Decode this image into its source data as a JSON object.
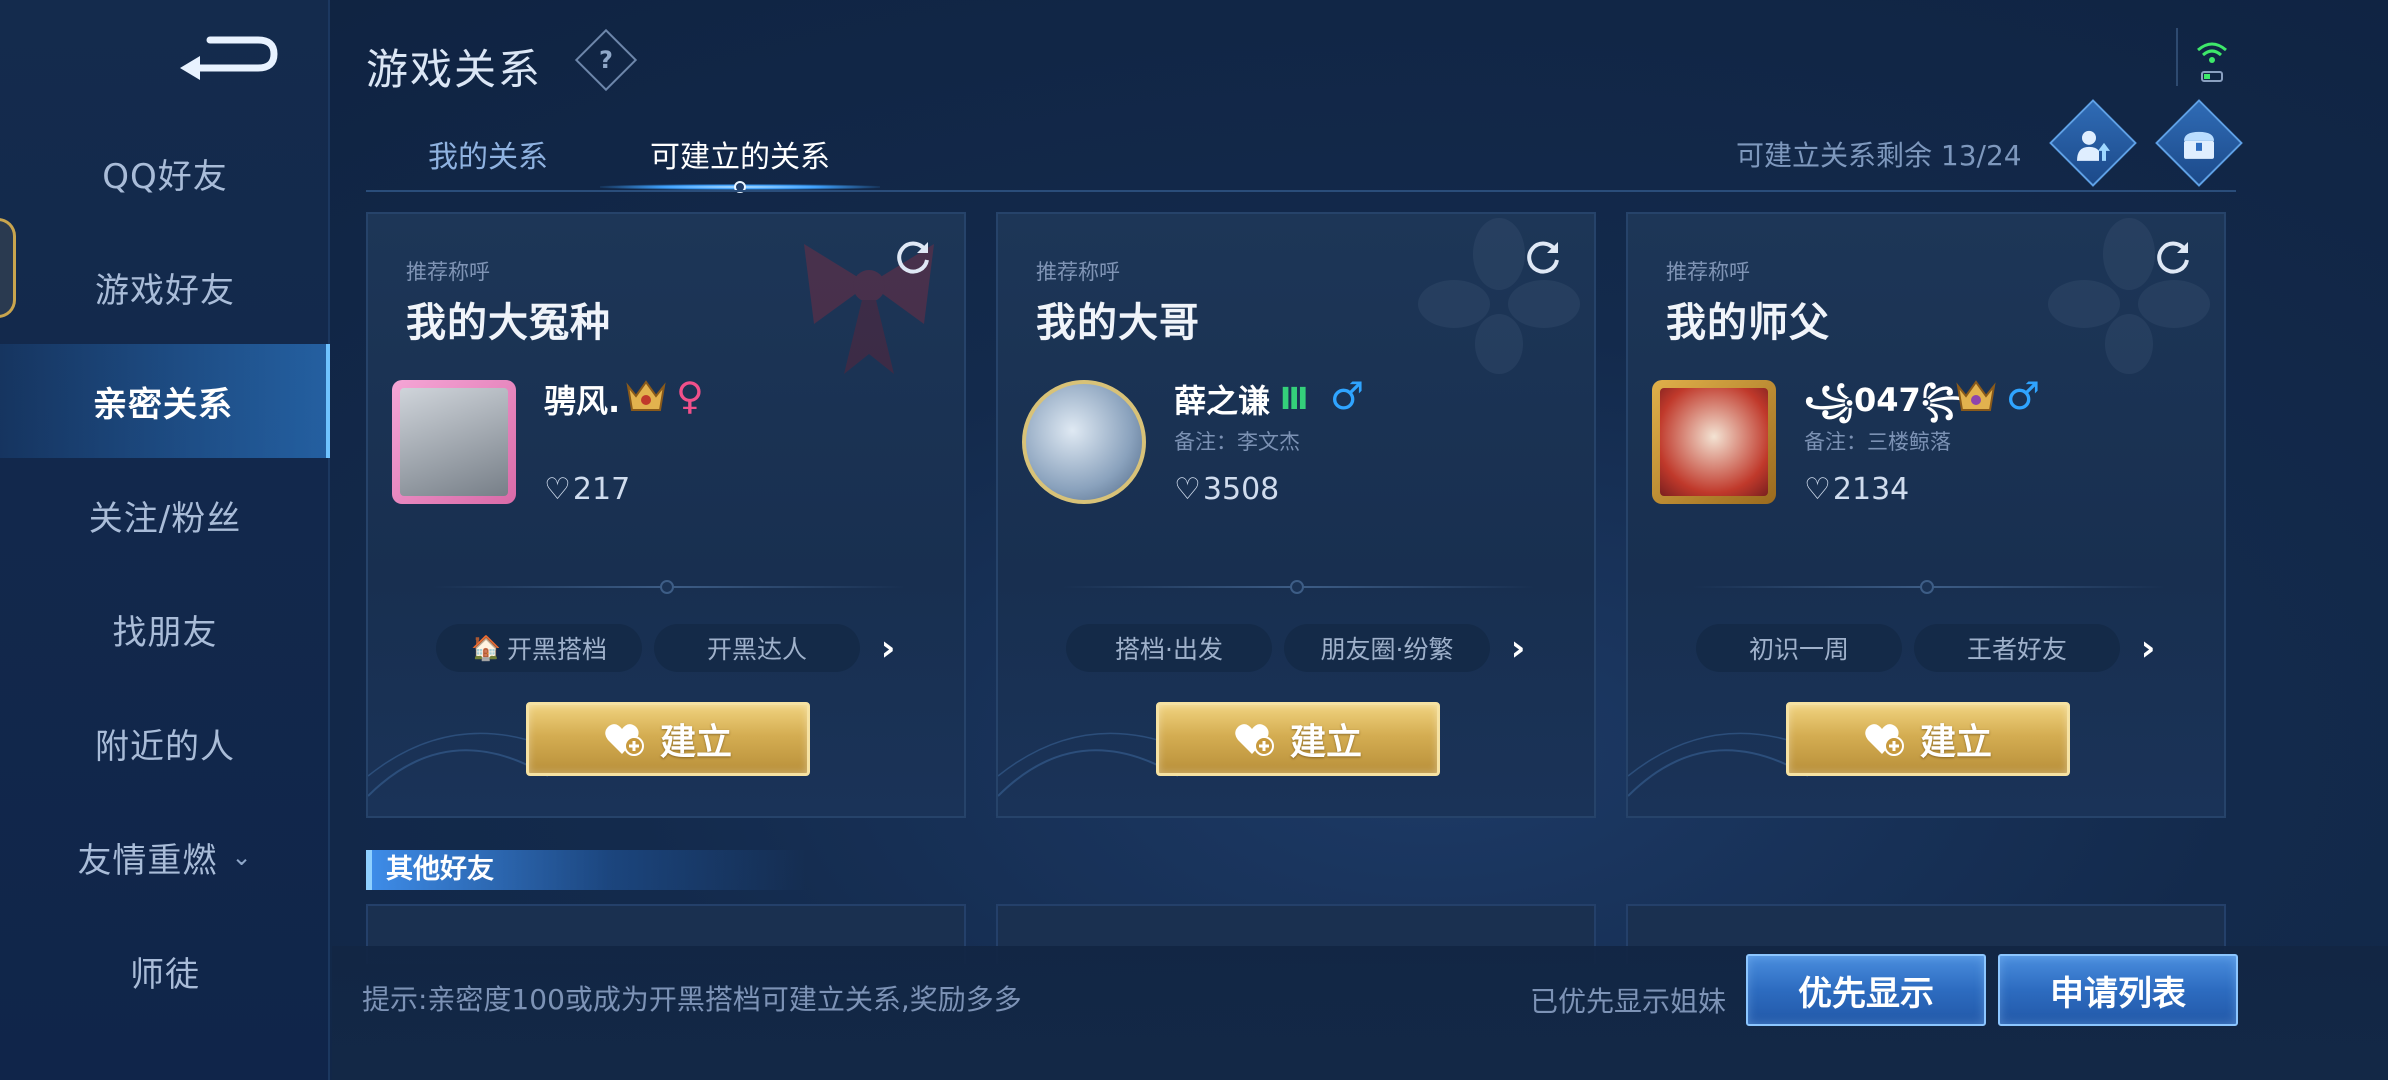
{
  "sidebar": {
    "items": [
      {
        "label": "QQ好友"
      },
      {
        "label": "游戏好友"
      },
      {
        "label": "亲密关系",
        "active": true
      },
      {
        "label": "关注/粉丝"
      },
      {
        "label": "找朋友"
      },
      {
        "label": "附近的人"
      },
      {
        "label": "友情重燃",
        "expandable": true
      },
      {
        "label": "师徒"
      }
    ]
  },
  "header": {
    "title": "游戏关系",
    "help_icon": "question-icon",
    "tabs": [
      {
        "label": "我的关系",
        "active": false
      },
      {
        "label": "可建立的关系",
        "active": true
      }
    ],
    "remaining_label": "可建立关系剩余 13/24",
    "remaining": 13,
    "remaining_total": 24
  },
  "cards": [
    {
      "rec_label": "推荐称呼",
      "title": "我的大冤种",
      "name": "骋风.",
      "gender": "♀",
      "gender_color": "#f0508a",
      "remark": "",
      "intimacy": "217",
      "tags": [
        "开黑搭档",
        "开黑达人"
      ],
      "button": "建立"
    },
    {
      "rec_label": "推荐称呼",
      "title": "我的大哥",
      "name": "薛之谦",
      "gender": "♂",
      "gender_color": "#2fa4ff",
      "remark": "备注：李文杰",
      "intimacy": "3508",
      "tags": [
        "搭档·出发",
        "朋友圈·纷繁"
      ],
      "button": "建立"
    },
    {
      "rec_label": "推荐称呼",
      "title": "我的师父",
      "name": "꧁047꧂",
      "gender": "♂",
      "gender_color": "#2fa4ff",
      "remark": "备注：三楼鲸落",
      "intimacy": "2134",
      "tags": [
        "初识一周",
        "王者好友"
      ],
      "button": "建立"
    }
  ],
  "other_friends": {
    "title": "其他好友"
  },
  "footer": {
    "hint": "提示:亲密度100或成为开黑搭档可建立关系,奖励多多",
    "pref_label": "已优先显示姐妹",
    "priority_button": "优先显示",
    "apply_button": "申请列表"
  },
  "colors": {
    "accent_gold": "#d4ad52",
    "accent_blue": "#3a7cd0",
    "background": "#132a4c"
  }
}
